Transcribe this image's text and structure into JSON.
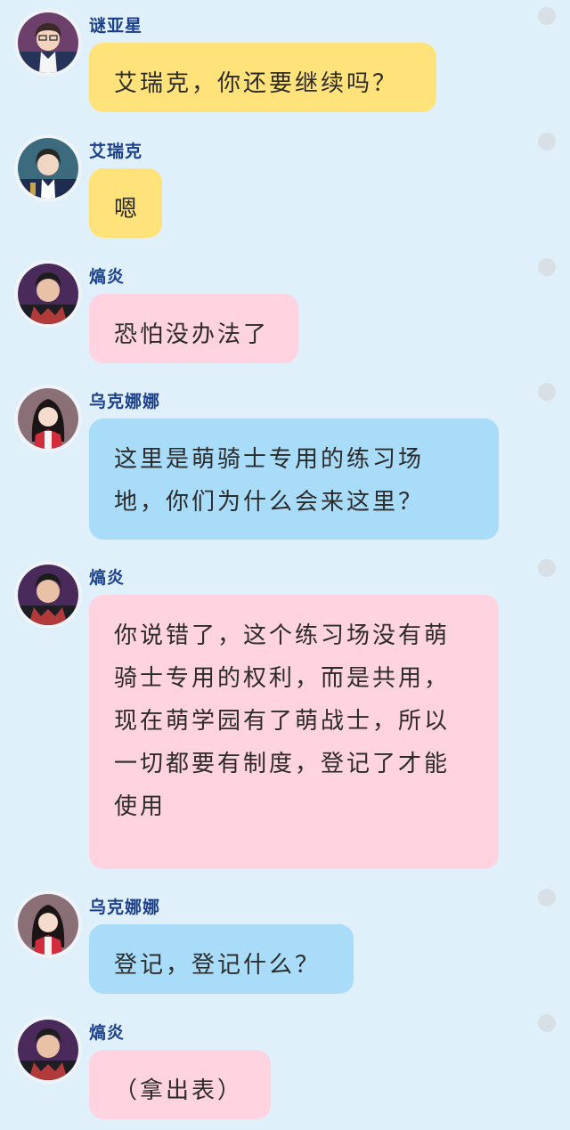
{
  "theme": {
    "background": "#dff0fb",
    "bubble_colors": {
      "yellow": "#ffe27a",
      "pink": "#ffd3df",
      "blue": "#a9dcf9"
    }
  },
  "messages": [
    {
      "sender": "谜亚星",
      "avatar": "avatar-miyaxing",
      "bubble_color": "yellow",
      "text": "艾瑞克，你还要继续吗？"
    },
    {
      "sender": "艾瑞克",
      "avatar": "avatar-airuike",
      "bubble_color": "yellow",
      "text": "嗯"
    },
    {
      "sender": "熇炎",
      "avatar": "avatar-heyan",
      "bubble_color": "pink",
      "text": "恐怕没办法了"
    },
    {
      "sender": "乌克娜娜",
      "avatar": "avatar-ukenana",
      "bubble_color": "blue",
      "text": "这里是萌骑士专用的练习场地，你们为什么会来这里？"
    },
    {
      "sender": "熇炎",
      "avatar": "avatar-heyan",
      "bubble_color": "pink",
      "text": "你说错了，这个练习场没有萌骑士专用的权利，而是共用，现在萌学园有了萌战士，所以一切都要有制度，登记了才能使用"
    },
    {
      "sender": "乌克娜娜",
      "avatar": "avatar-ukenana",
      "bubble_color": "blue",
      "text": "登记，登记什么？"
    },
    {
      "sender": "熇炎",
      "avatar": "avatar-heyan",
      "bubble_color": "pink",
      "text": "（拿出表）"
    }
  ]
}
